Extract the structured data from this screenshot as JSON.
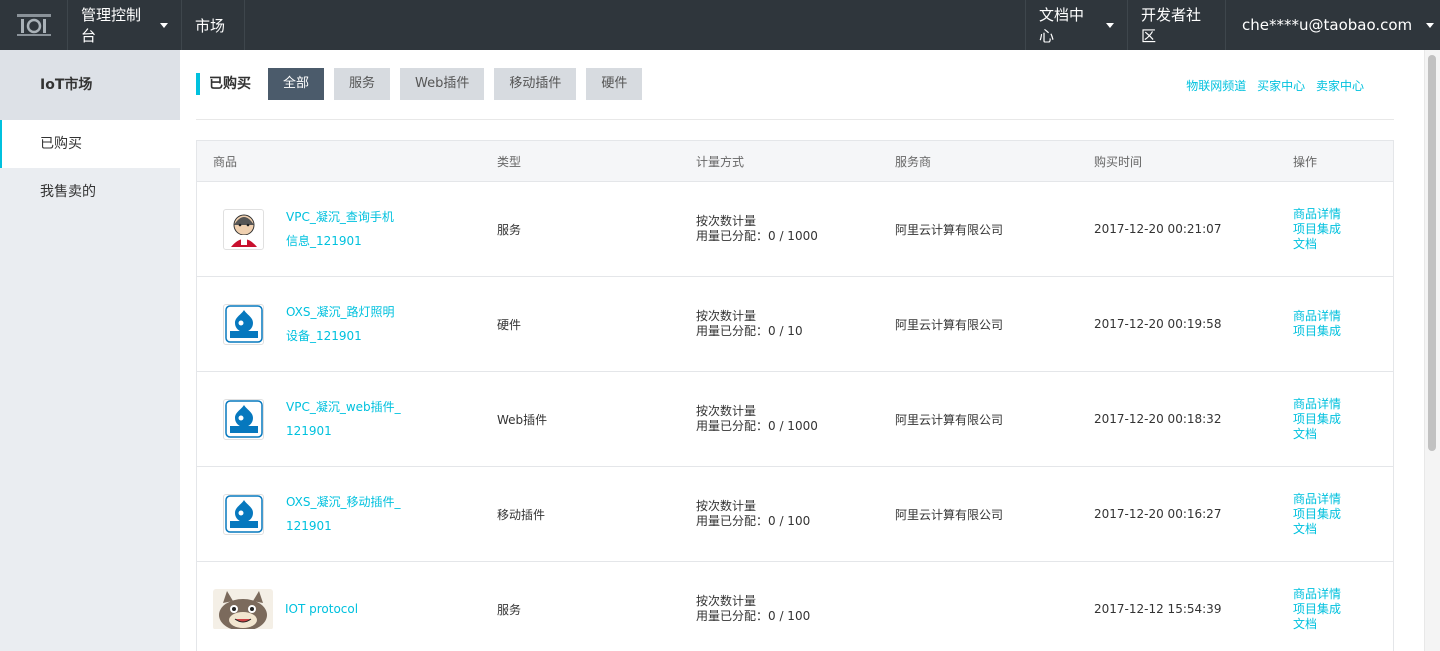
{
  "topbar": {
    "logo_text": "IoT",
    "console_label": "管理控制台",
    "market_label": "市场",
    "docs_label": "文档中心",
    "dev_label": "开发者社区",
    "user_label": "che****u@taobao.com"
  },
  "sidebar": {
    "title": "IoT市场",
    "items": [
      {
        "label": "已购买"
      },
      {
        "label": "我售卖的"
      }
    ]
  },
  "filter": {
    "title": "已购买",
    "tabs": [
      {
        "label": "全部"
      },
      {
        "label": "服务"
      },
      {
        "label": "Web插件"
      },
      {
        "label": "移动插件"
      },
      {
        "label": "硬件"
      }
    ],
    "links": [
      {
        "label": "物联网频道"
      },
      {
        "label": "买家中心"
      },
      {
        "label": "卖家中心"
      }
    ]
  },
  "table": {
    "headers": [
      "商品",
      "类型",
      "计量方式",
      "服务商",
      "购买时间",
      "操作"
    ],
    "rows": [
      {
        "icon": "jenkins-icon",
        "name_line1": "VPC_凝沉_查询手机",
        "name_line2": "信息_121901",
        "type": "服务",
        "meter_line1": "按次数计量",
        "meter_line2": "用量已分配：0 / 1000",
        "provider": "阿里云计算有限公司",
        "time": "2017-12-20 00:21:07",
        "ops": [
          "商品详情",
          "项目集成",
          "文档"
        ]
      },
      {
        "icon": "drupal-icon",
        "name_line1": "OXS_凝沉_路灯照明",
        "name_line2": "设备_121901",
        "type": "硬件",
        "meter_line1": "按次数计量",
        "meter_line2": "用量已分配：0 / 10",
        "provider": "阿里云计算有限公司",
        "time": "2017-12-20 00:19:58",
        "ops": [
          "商品详情",
          "项目集成"
        ]
      },
      {
        "icon": "drupal-icon",
        "name_line1": "VPC_凝沉_web插件_",
        "name_line2": "121901",
        "type": "Web插件",
        "meter_line1": "按次数计量",
        "meter_line2": "用量已分配：0 / 1000",
        "provider": "阿里云计算有限公司",
        "time": "2017-12-20 00:18:32",
        "ops": [
          "商品详情",
          "项目集成",
          "文档"
        ]
      },
      {
        "icon": "drupal-icon",
        "name_line1": "OXS_凝沉_移动插件_",
        "name_line2": "121901",
        "type": "移动插件",
        "meter_line1": "按次数计量",
        "meter_line2": "用量已分配：0 / 100",
        "provider": "阿里云计算有限公司",
        "time": "2017-12-20 00:16:27",
        "ops": [
          "商品详情",
          "项目集成",
          "文档"
        ]
      },
      {
        "icon": "cat-mascot-icon",
        "name_line1": "IOT protocol",
        "name_line2": "",
        "type": "服务",
        "meter_line1": "按次数计量",
        "meter_line2": "用量已分配：0 / 100",
        "provider": "",
        "time": "2017-12-12 15:54:39",
        "ops": [
          "商品详情",
          "项目集成",
          "文档"
        ]
      }
    ]
  },
  "colors": {
    "topbar": "#2f363c",
    "accent": "#00c1de",
    "active_tab": "#4b5b6b",
    "sidebar": "#eaedf1"
  }
}
